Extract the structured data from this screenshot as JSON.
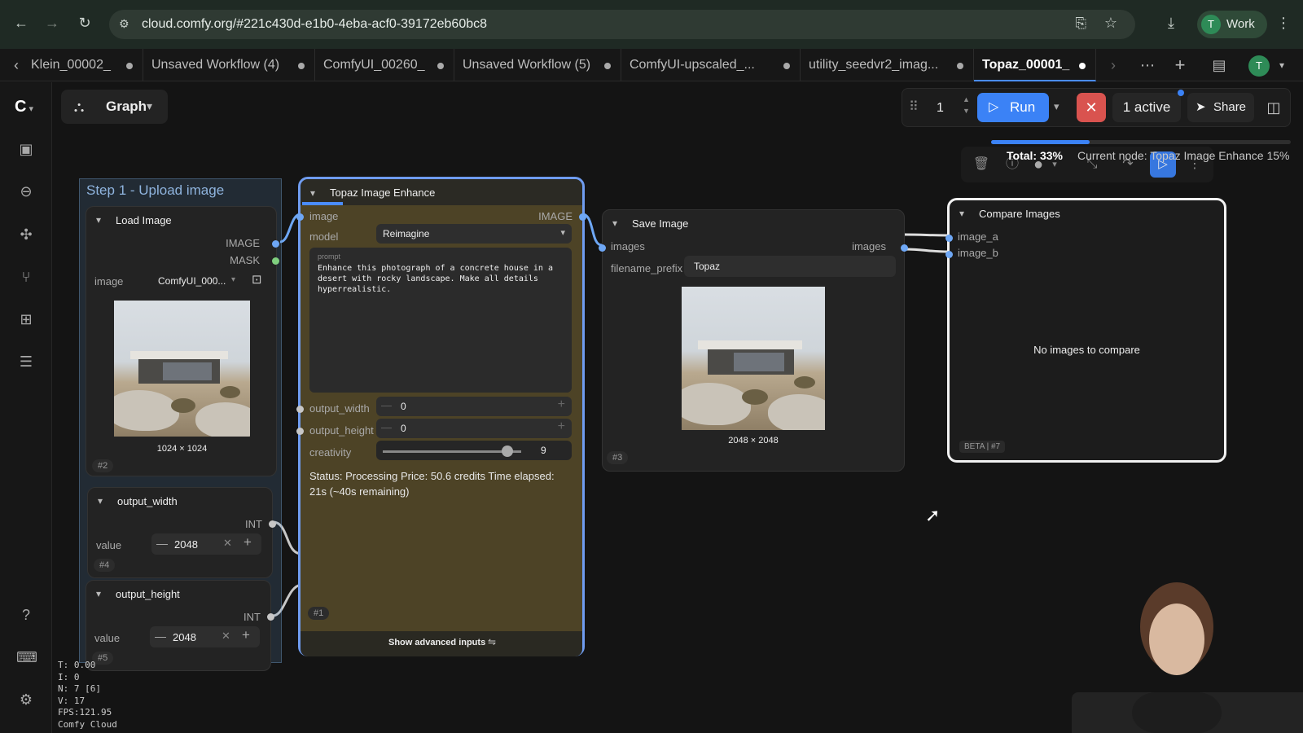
{
  "browser": {
    "url": "cloud.comfy.org/#221c430d-e1b0-4eba-acf0-39172eb60bc8",
    "profile_initial": "T",
    "profile_name": "Work"
  },
  "tabs": [
    {
      "label": "Klein_00002_",
      "active": false
    },
    {
      "label": "Unsaved Workflow (4)",
      "active": false
    },
    {
      "label": "ComfyUI_00260_",
      "active": false
    },
    {
      "label": "Unsaved Workflow (5)",
      "active": false
    },
    {
      "label": "ComfyUI-upscaled_...",
      "active": false
    },
    {
      "label": "utility_seedvr2_imag...",
      "active": false
    },
    {
      "label": "Topaz_00001_",
      "active": true
    }
  ],
  "tabbar_avatar": "T",
  "toolbar": {
    "graph_label": "Graph",
    "batch_count": "1",
    "run_label": "Run",
    "active_label": "1 active",
    "share_label": "Share"
  },
  "progress": {
    "total_label": "Total: 33%",
    "total_fraction": 0.33,
    "current_node_label": "Current node: Topaz Image Enhance 15%"
  },
  "groups": {
    "step1_title": "Step 1 - Upload image"
  },
  "load_image": {
    "title": "Load Image",
    "out_image": "IMAGE",
    "out_mask": "MASK",
    "image_label": "image",
    "image_value": "ComfyUI_000...",
    "caption": "1024 × 1024",
    "id": "#2"
  },
  "output_width_node": {
    "title": "output_width",
    "out_type": "INT",
    "value_label": "value",
    "value": "2048",
    "id": "#4"
  },
  "output_height_node": {
    "title": "output_height",
    "out_type": "INT",
    "value_label": "value",
    "value": "2048",
    "id": "#5"
  },
  "topaz": {
    "title": "Topaz Image Enhance",
    "in_image": "image",
    "out_image": "IMAGE",
    "model_label": "model",
    "model_value": "Reimagine",
    "prompt_label": "prompt",
    "prompt_text": "Enhance this photograph of a concrete house in a desert with rocky landscape.  Make all details hyperrealistic.",
    "output_width_label": "output_width",
    "output_width_value": "0",
    "output_height_label": "output_height",
    "output_height_value": "0",
    "creativity_label": "creativity",
    "creativity_value": "9",
    "creativity_fraction": 0.9,
    "status": "Status: Processing Price: 50.6 credits Time elapsed: 21s (~40s remaining)",
    "id": "#1",
    "advanced_label": "Show advanced inputs"
  },
  "save_image": {
    "title": "Save Image",
    "in_images": "images",
    "out_images": "images",
    "prefix_label": "filename_prefix",
    "prefix_value": "Topaz",
    "caption": "2048 × 2048",
    "id": "#3"
  },
  "compare": {
    "title": "Compare Images",
    "in_a": "image_a",
    "in_b": "image_b",
    "empty_text": "No images to compare",
    "beta_label": "BETA | #7"
  },
  "stats": {
    "line1": "T: 0.00",
    "line2": "I: 0",
    "line3": "N: 7 [6]",
    "line4": "V: 17",
    "line5": "FPS:121.95",
    "line6": "Comfy Cloud"
  },
  "colors": {
    "accent": "#3b82f6",
    "danger": "#d9534f",
    "topaz_body": "#4d4326",
    "selection": "#6f9cf0",
    "image_socket": "#6ea7f5",
    "mask_socket": "#7fcf7f",
    "int_socket": "#c7c7c7"
  }
}
